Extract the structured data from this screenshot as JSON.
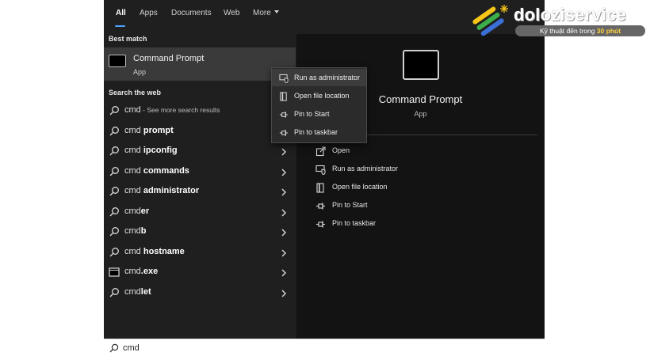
{
  "tabs": [
    {
      "label": "All",
      "active": true
    },
    {
      "label": "Apps"
    },
    {
      "label": "Documents"
    },
    {
      "label": "Web"
    },
    {
      "label": "More"
    }
  ],
  "best_match": {
    "section": "Best match",
    "title": "Command Prompt",
    "subtitle": "App"
  },
  "web": {
    "section": "Search the web",
    "items": [
      {
        "prefix": "cmd",
        "bold": "",
        "note": " - See more search results",
        "icon": "search-icon"
      },
      {
        "prefix": "cmd ",
        "bold": "prompt",
        "icon": "search-icon"
      },
      {
        "prefix": "cmd ",
        "bold": "ipconfig",
        "icon": "search-icon"
      },
      {
        "prefix": "cmd ",
        "bold": "commands",
        "icon": "search-icon"
      },
      {
        "prefix": "cmd ",
        "bold": "administrator",
        "icon": "search-icon"
      },
      {
        "prefix": "cmd",
        "bold": "er",
        "icon": "search-icon"
      },
      {
        "prefix": "cmd",
        "bold": "b",
        "icon": "search-icon"
      },
      {
        "prefix": "cmd ",
        "bold": "hostname",
        "icon": "search-icon"
      },
      {
        "prefix": "cmd",
        "bold": ".exe",
        "icon": "window-app-icon"
      },
      {
        "prefix": "cmd",
        "bold": "let",
        "icon": "search-icon"
      }
    ]
  },
  "detail": {
    "title": "Command Prompt",
    "subtitle": "App",
    "actions": [
      {
        "label": "Open",
        "icon": "open-icon"
      },
      {
        "label": "Run as administrator",
        "icon": "shield-admin-icon"
      },
      {
        "label": "Open file location",
        "icon": "folder-location-icon"
      },
      {
        "label": "Pin to Start",
        "icon": "pin-icon"
      },
      {
        "label": "Pin to taskbar",
        "icon": "pin-icon"
      }
    ]
  },
  "context_menu": {
    "items": [
      {
        "label": "Run as administrator",
        "icon": "shield-admin-icon",
        "highlighted": true
      },
      {
        "label": "Open file location",
        "icon": "folder-location-icon"
      },
      {
        "label": "Pin to Start",
        "icon": "pin-icon"
      },
      {
        "label": "Pin to taskbar",
        "icon": "pin-icon"
      }
    ]
  },
  "search": {
    "value": "cmd"
  },
  "watermark": {
    "brand": "doloziservice",
    "tagline": "Kỹ thuật đến trong ",
    "tagline_highlight": "30 phút",
    "accent": "#ffd23c"
  }
}
